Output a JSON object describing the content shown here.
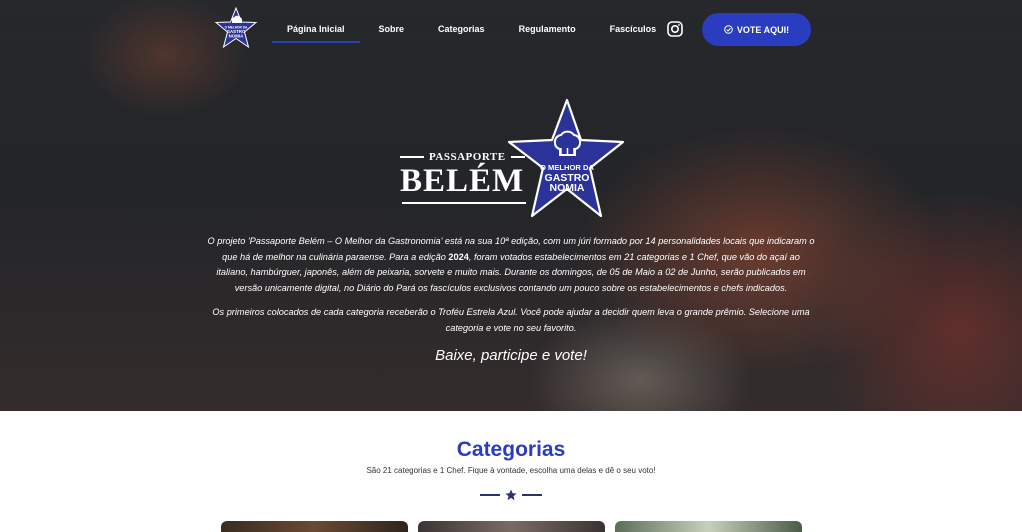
{
  "nav": {
    "logo": {
      "line1": "O MELHOR DA",
      "line2": "GASTRO",
      "line3": "NOMIA",
      "icon": "chef-hat-star-logo"
    },
    "items": [
      {
        "label": "Página Inicial",
        "active": true
      },
      {
        "label": "Sobre",
        "active": false
      },
      {
        "label": "Categorias",
        "active": false
      },
      {
        "label": "Regulamento",
        "active": false
      },
      {
        "label": "Fascículos",
        "active": false
      }
    ],
    "instagram_icon": "instagram-icon",
    "vote_button": "VOTE AQUI!"
  },
  "hero": {
    "logo": {
      "top": "PASSAPORTE",
      "main": "BELÉM",
      "star_line1": "O MELHOR DA",
      "star_line2": "GASTRO",
      "star_line3": "NOMIA"
    },
    "paragraph1_a": "O projeto 'Passaporte Belém – O Melhor da Gastronomia' está na sua 10ª edição, com um júri formado por 14 personalidades locais que indicaram o que há de melhor na culinária paraense. Para a edição ",
    "paragraph1_year": "2024",
    "paragraph1_b": ", foram votados estabelecimentos em 21 categorias e 1 Chef, que vão do açaí ao italiano, hambúrguer, japonês, além de peixaria, sorvete e muito mais. Durante os domingos, de 05 de Maio a 02 de Junho, serão publicados em versão unicamente digital, no Diário do Pará os fascículos exclusivos contando um pouco sobre os estabelecimentos e chefs indicados.",
    "paragraph2": "Os primeiros colocados de cada categoria receberão o Troféu Estrela Azul. Você pode ajudar a decidir quem leva o grande prêmio. Selecione uma categoria e vote no seu favorito.",
    "cta": "Baixe, participe e vote!"
  },
  "categories": {
    "title": "Categorias",
    "subtitle": "São 21 categorias e 1 Chef. Fique à vontade, escolha uma delas e dê o seu voto!",
    "divider_icon": "star-icon"
  },
  "colors": {
    "brand": "#2a3dc0",
    "brand_dark": "#2a3070"
  }
}
